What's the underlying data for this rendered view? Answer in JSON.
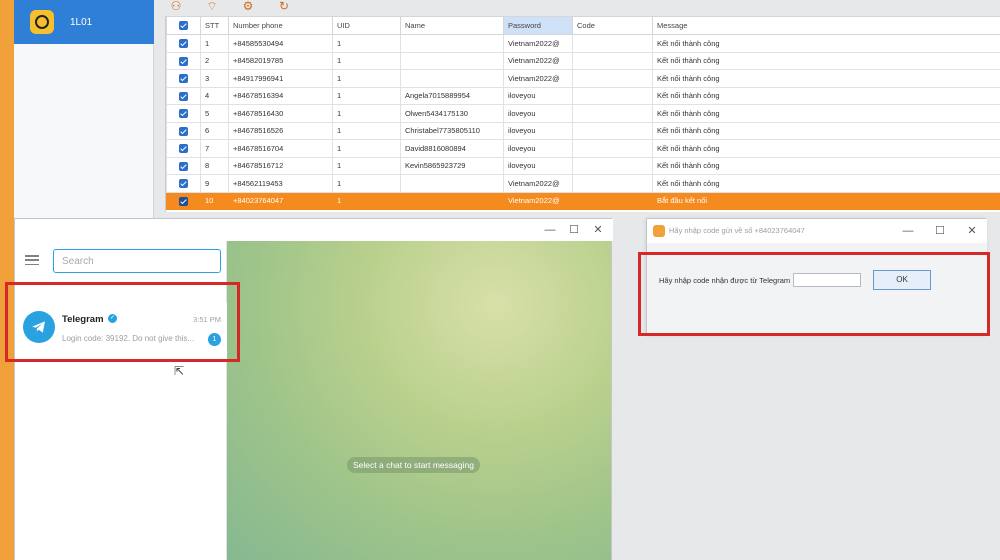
{
  "app": {
    "sidebar_item": "1L01"
  },
  "table": {
    "headers": [
      "STT",
      "Number phone",
      "UID",
      "Name",
      "Password",
      "Code",
      "Message"
    ],
    "rows": [
      {
        "stt": "1",
        "phone": "+84585530494",
        "uid": "1",
        "name": "",
        "password": "Vietnam2022@",
        "code": "",
        "message": "Kết nối thành công"
      },
      {
        "stt": "2",
        "phone": "+84582019785",
        "uid": "1",
        "name": "",
        "password": "Vietnam2022@",
        "code": "",
        "message": "Kết nối thành công"
      },
      {
        "stt": "3",
        "phone": "+84917996941",
        "uid": "1",
        "name": "",
        "password": "Vietnam2022@",
        "code": "",
        "message": "Kết nối thành công"
      },
      {
        "stt": "4",
        "phone": "+84678516394",
        "uid": "1",
        "name": "Angela7015889954",
        "password": "iloveyou",
        "code": "",
        "message": "Kết nối thành công"
      },
      {
        "stt": "5",
        "phone": "+84678516430",
        "uid": "1",
        "name": "Olwen5434175130",
        "password": "iloveyou",
        "code": "",
        "message": "Kết nối thành công"
      },
      {
        "stt": "6",
        "phone": "+84678516526",
        "uid": "1",
        "name": "Christabel7735805110",
        "password": "iloveyou",
        "code": "",
        "message": "Kết nối thành công"
      },
      {
        "stt": "7",
        "phone": "+84678516704",
        "uid": "1",
        "name": "David8816080894",
        "password": "iloveyou",
        "code": "",
        "message": "Kết nối thành công"
      },
      {
        "stt": "8",
        "phone": "+84678516712",
        "uid": "1",
        "name": "Kevin5865923729",
        "password": "iloveyou",
        "code": "",
        "message": "Kết nối thành công"
      },
      {
        "stt": "9",
        "phone": "+84562119453",
        "uid": "1",
        "name": "",
        "password": "Vietnam2022@",
        "code": "",
        "message": "Kết nối thành công"
      },
      {
        "stt": "10",
        "phone": "+84023764047",
        "uid": "1",
        "name": "",
        "password": "Vietnam2022@",
        "code": "",
        "message": "Bắt đầu kết nối"
      }
    ]
  },
  "telegram": {
    "search_placeholder": "Search",
    "chat": {
      "name": "Telegram",
      "time": "3:51 PM",
      "preview": "Login code: 39192. Do not give this...",
      "unread": "1"
    },
    "empty_hint": "Select a chat to start messaging"
  },
  "dialog": {
    "title": "Hãy nhập code gửi về số +84023764047",
    "label": "Hãy nhập code nhận được từ Telegram",
    "ok": "OK"
  },
  "colors": {
    "accent_orange": "#f58a1f",
    "telegram_blue": "#2aa1e0",
    "highlight_red": "#d62828",
    "selected_blue": "#2f7fd6"
  }
}
